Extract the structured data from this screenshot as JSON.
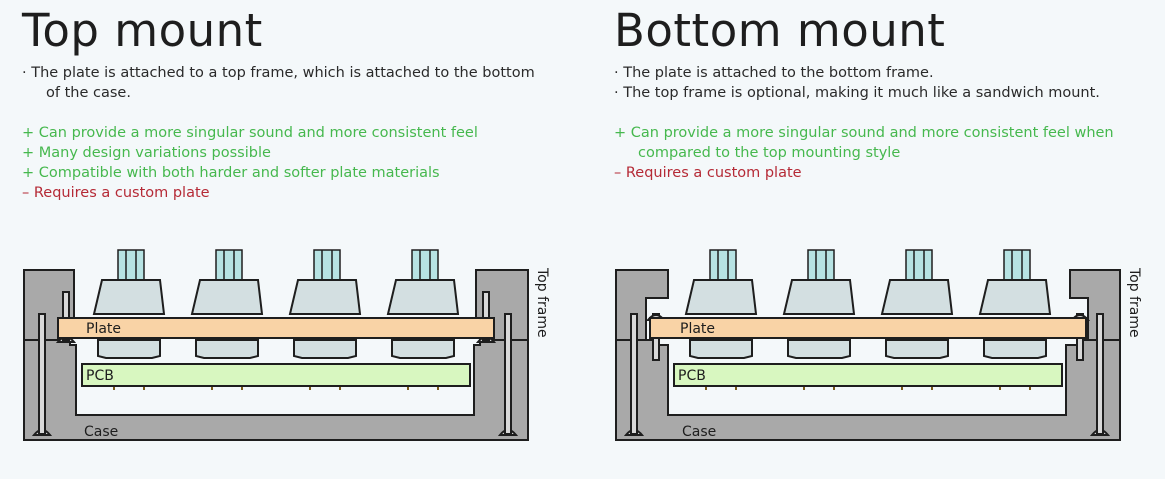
{
  "colors": {
    "background": "#f4f8fa",
    "pro": "#46b84e",
    "con": "#b52a36",
    "case": "#a9a9a9",
    "plate": "#f9d3a6",
    "pcb": "#d8f7c0",
    "switch_housing": "#d3dfe1",
    "stem": "#b7e3e3"
  },
  "left": {
    "title": "Top mount",
    "notes": [
      "· The plate is attached to a top frame, which is attached to the bottom",
      "of the case."
    ],
    "pros": [
      "+ Can provide a more singular sound and more consistent feel",
      "+ Many design variations possible",
      "+ Compatible with both harder and softer plate materials"
    ],
    "cons": [
      "– Requires a custom plate"
    ],
    "diagram": {
      "plate_label": "Plate",
      "pcb_label": "PCB",
      "case_label": "Case",
      "top_frame_label": "Top frame",
      "switch_count": 4
    }
  },
  "right": {
    "title": "Bottom mount",
    "notes": [
      "· The plate is attached to the bottom frame.",
      "· The top frame is optional, making it much like a sandwich mount."
    ],
    "pros": [
      "+ Can provide a more singular sound and more consistent feel when",
      "compared to the top mounting style"
    ],
    "cons": [
      "– Requires a custom plate"
    ],
    "diagram": {
      "plate_label": "Plate",
      "pcb_label": "PCB",
      "case_label": "Case",
      "top_frame_label": "Top frame",
      "switch_count": 4
    }
  }
}
